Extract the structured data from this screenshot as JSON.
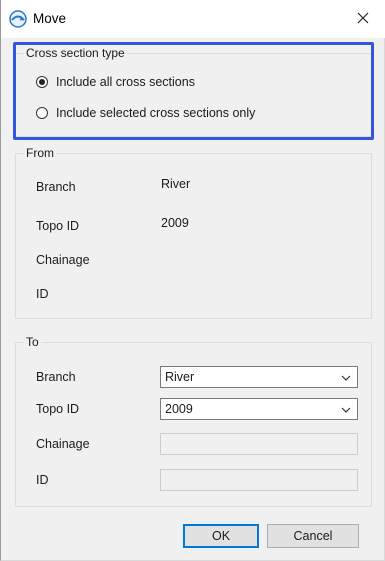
{
  "window": {
    "title": "Move"
  },
  "cross_section_type": {
    "legend": "Cross section type",
    "options": [
      {
        "label": "Include all cross sections",
        "selected": true
      },
      {
        "label": "Include selected cross sections only",
        "selected": false
      }
    ]
  },
  "from": {
    "legend": "From",
    "rows": [
      {
        "label": "Branch",
        "value": "River"
      },
      {
        "label": "Topo ID",
        "value": "2009"
      },
      {
        "label": "Chainage",
        "value": ""
      },
      {
        "label": "ID",
        "value": ""
      }
    ]
  },
  "to": {
    "legend": "To",
    "branch_label": "Branch",
    "branch_value": "River",
    "topo_label": "Topo ID",
    "topo_value": "2009",
    "chainage_label": "Chainage",
    "id_label": "ID"
  },
  "buttons": {
    "ok": "OK",
    "cancel": "Cancel"
  },
  "colors": {
    "highlight": "#3355dd",
    "default_button_border": "#0078d7"
  },
  "icons": {
    "app": "move-app-icon",
    "close": "close-icon",
    "dropdown": "chevron-down-icon"
  }
}
